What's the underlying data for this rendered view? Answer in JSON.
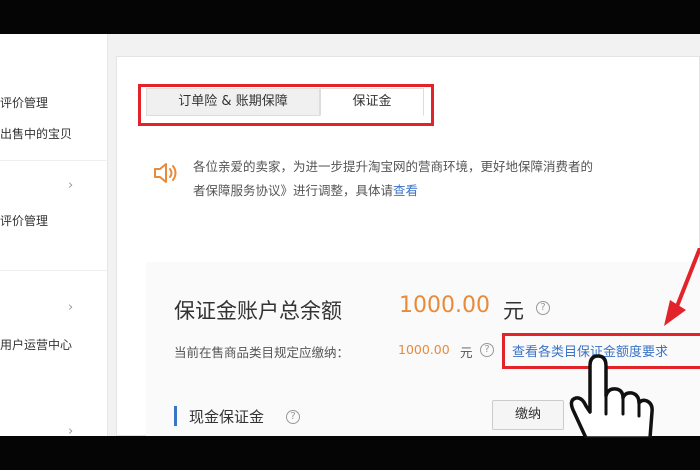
{
  "sidebar": {
    "items": [
      {
        "label": "评价管理"
      },
      {
        "label": "出售中的宝贝"
      },
      {
        "label": "评价管理"
      },
      {
        "label": "用户运营中心"
      }
    ]
  },
  "tabs": [
    {
      "label": "订单险 & 账期保障",
      "active": false
    },
    {
      "label": "保证金",
      "active": true
    }
  ],
  "notice": {
    "icon": "speaker-icon",
    "line1": "各位亲爱的卖家，为进一步提升淘宝网的营商环境，更好地保障消费者的",
    "line2": "者保障服务协议》进行调整，具体请",
    "link": "查看"
  },
  "deposit": {
    "balance_label": "保证金账户总余额",
    "balance_amount": "1000.00",
    "balance_unit": "元",
    "required_label": "当前在售商品类目规定应缴纳：",
    "required_amount": "1000.00",
    "required_unit": "元",
    "required_link": "查看各类目保证金额度要求",
    "cash_label": "现金保证金",
    "pay_button": "缴纳"
  },
  "colors": {
    "accent_orange": "#e98a3b",
    "link_blue": "#3b73c6",
    "highlight_red": "#e2232a"
  }
}
